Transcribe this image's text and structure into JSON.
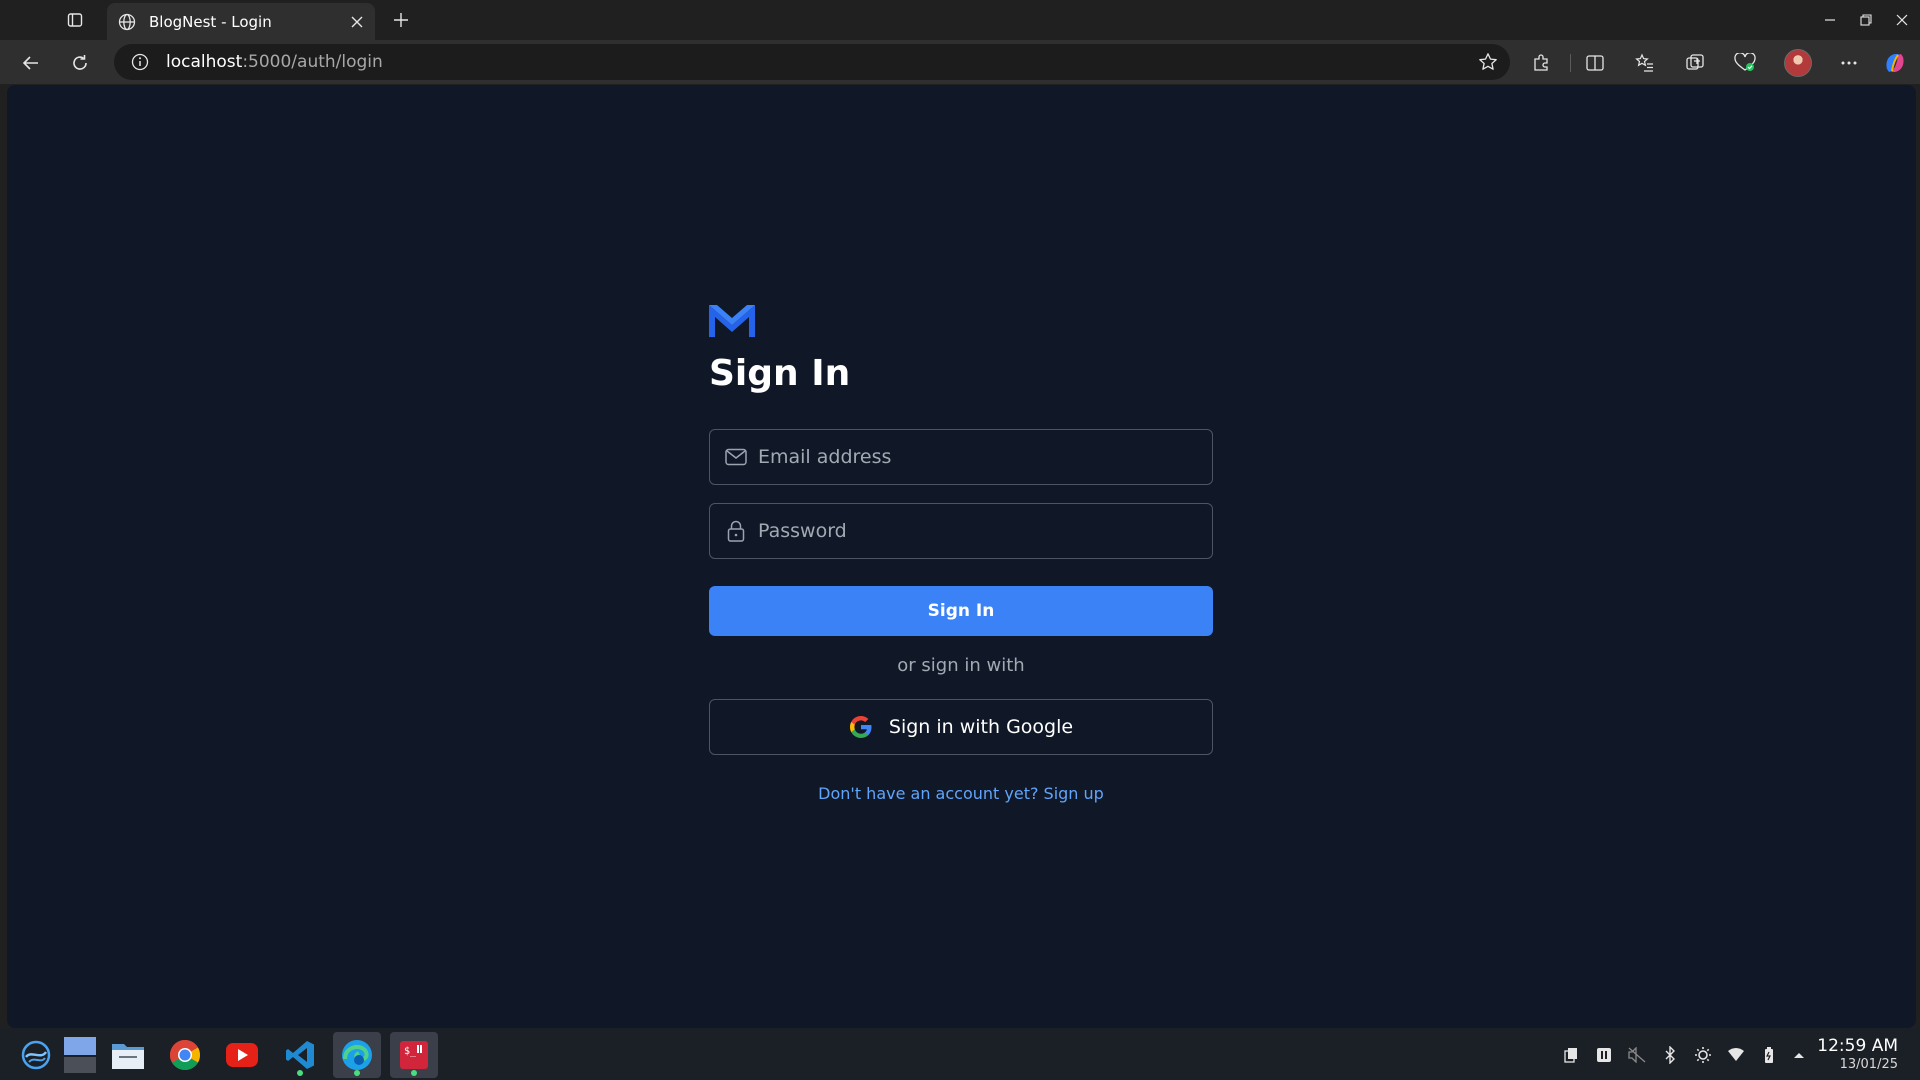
{
  "browser": {
    "tab": {
      "title": "BlogNest - Login",
      "favicon": "globe-icon"
    },
    "address": {
      "host": "localhost",
      "path": ":5000/auth/login"
    }
  },
  "page": {
    "title": "Sign In",
    "logo_icon": "m-logo-icon",
    "email": {
      "placeholder": "Email address",
      "value": "",
      "icon": "mail-icon"
    },
    "password": {
      "placeholder": "Password",
      "value": "",
      "icon": "lock-icon"
    },
    "signin_button": "Sign In",
    "divider_text": "or sign in with",
    "google_button": "Sign in with Google",
    "signup_link": "Don't have an account yet? Sign up",
    "colors": {
      "background": "#101828",
      "primary": "#3b82f6",
      "link": "#60a5fa",
      "border": "#4b5563"
    }
  },
  "taskbar": {
    "apps": [
      "start-icon",
      "desktop-icon",
      "file-explorer-icon",
      "chrome-icon",
      "youtube-icon",
      "vscode-icon",
      "edge-icon",
      "terminal-icon"
    ],
    "clock": {
      "time": "12:59 AM",
      "date": "13/01/25"
    }
  }
}
